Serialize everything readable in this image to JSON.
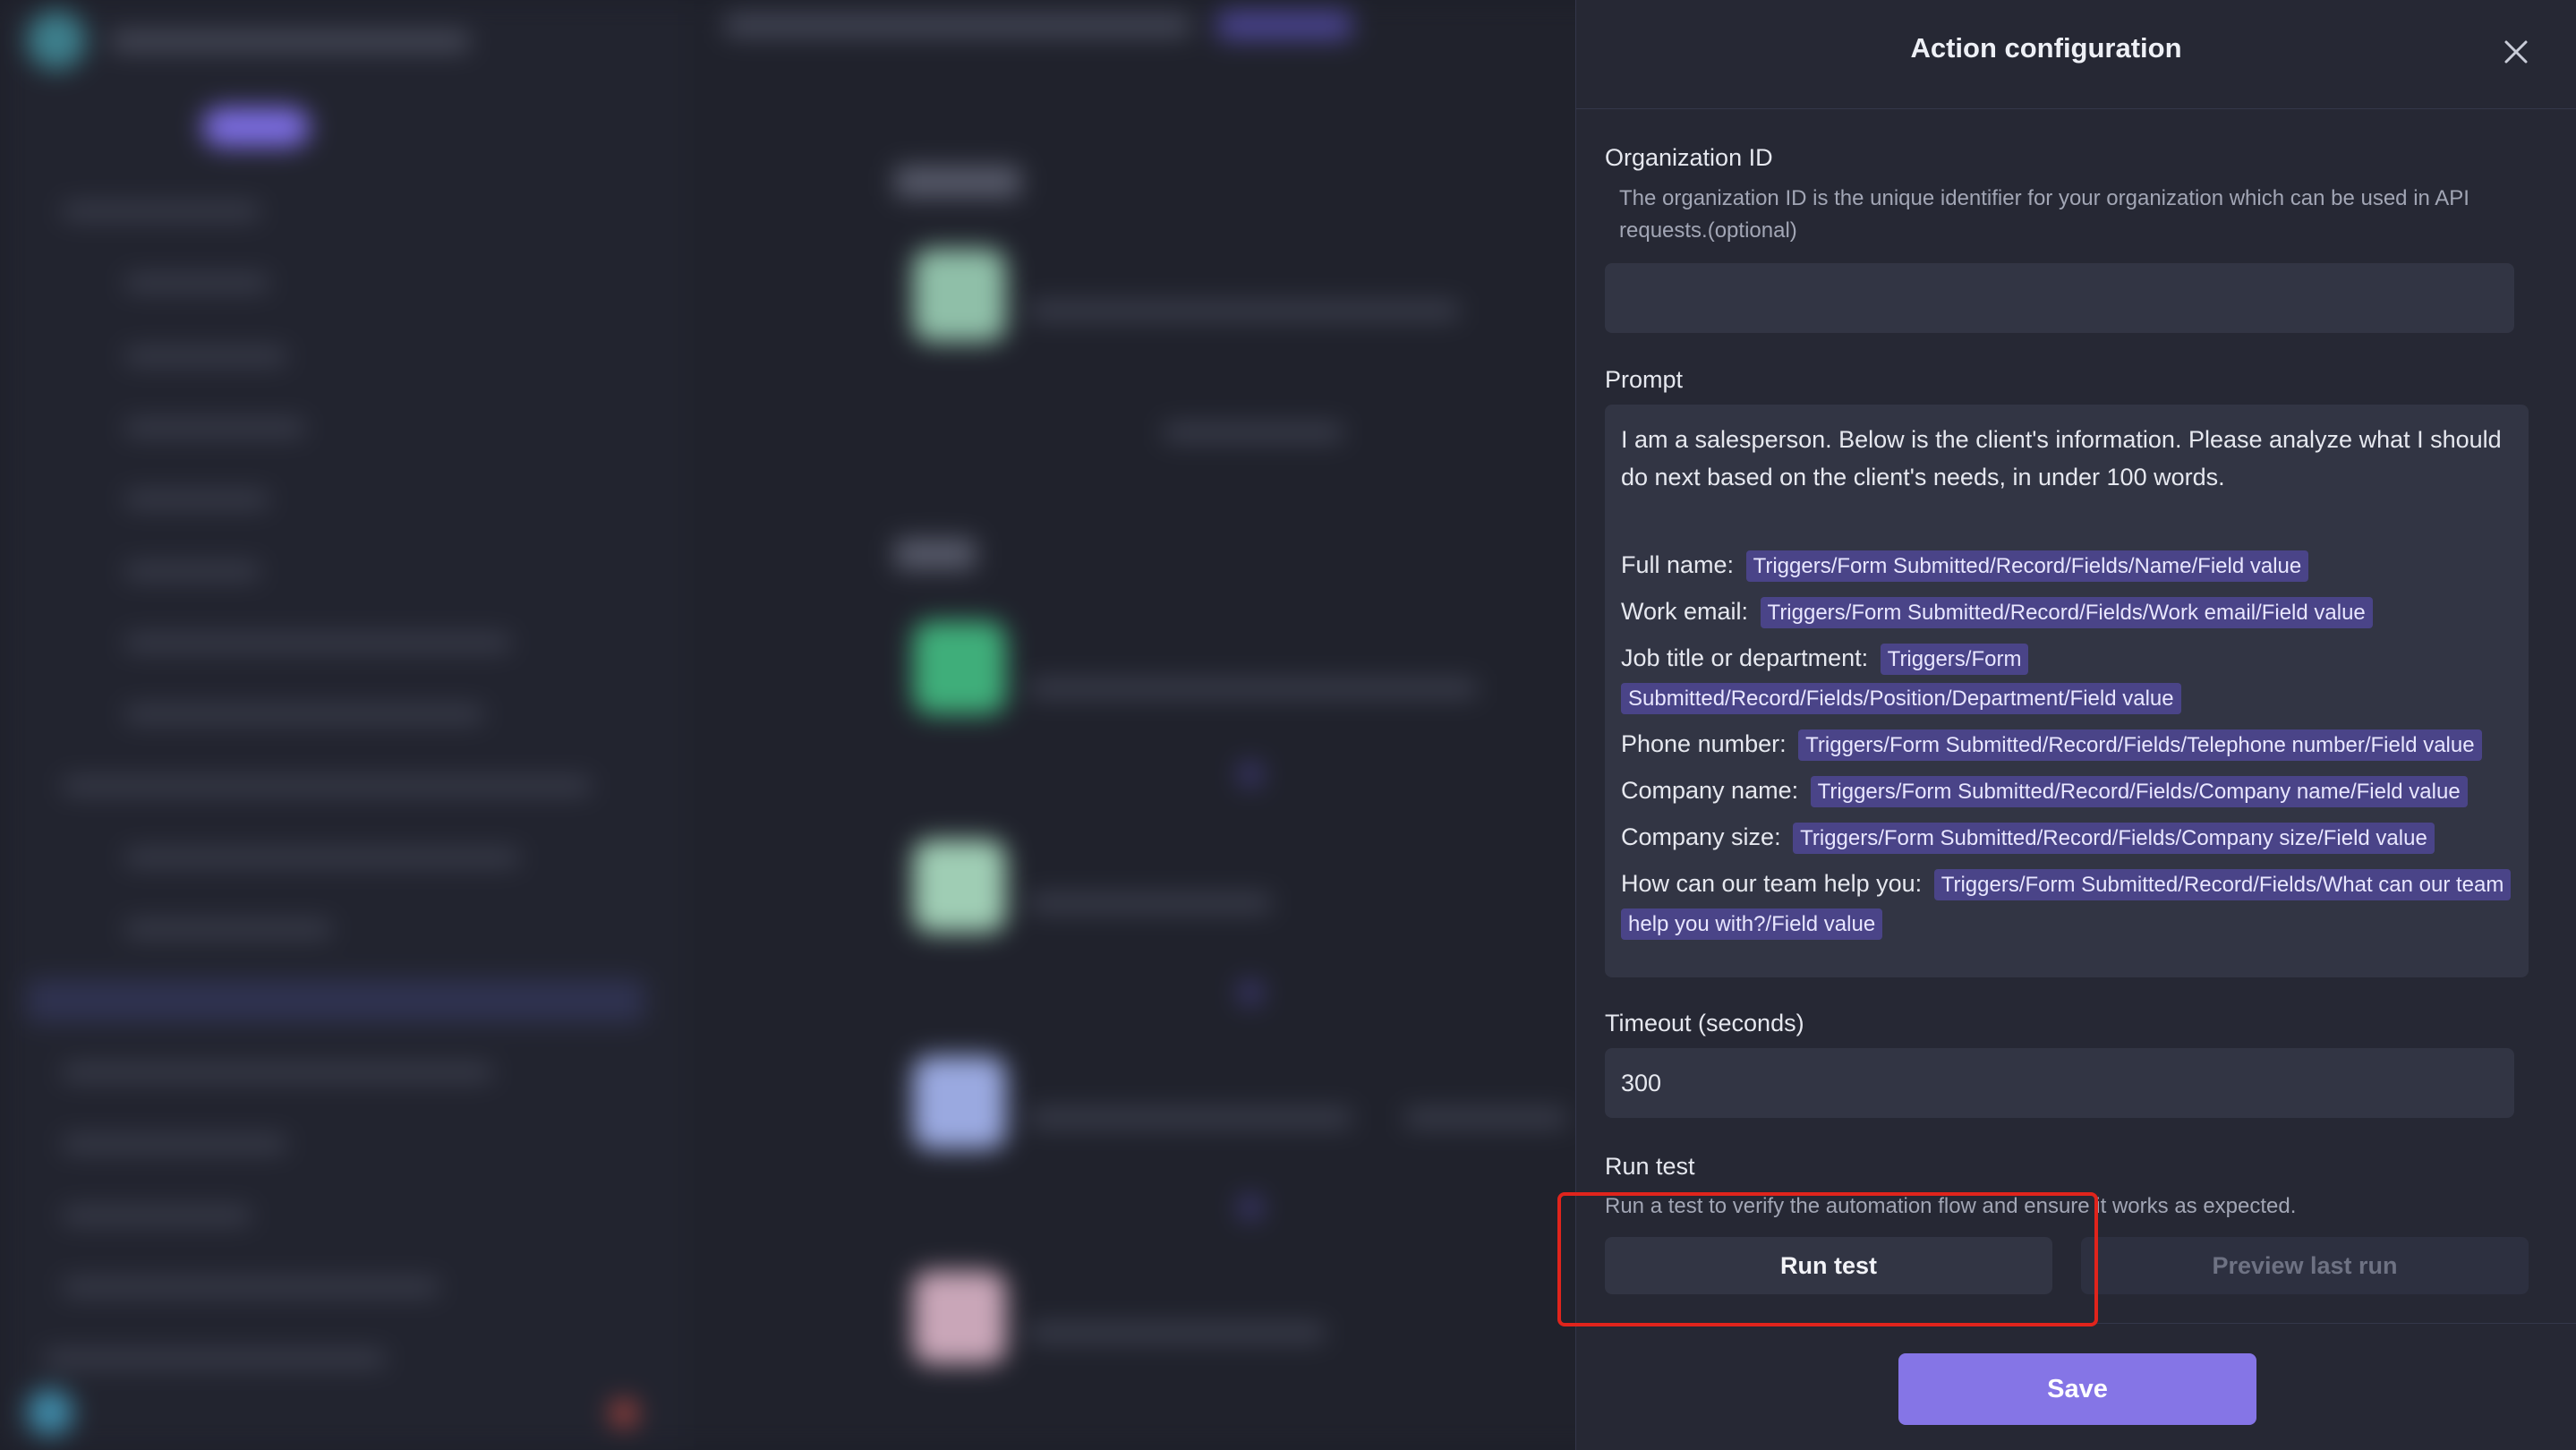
{
  "panel": {
    "title": "Action configuration"
  },
  "organization_id": {
    "label": "Organization ID",
    "description": "The organization ID is the unique identifier for your organization which can be used in API requests.(optional)",
    "value": ""
  },
  "prompt": {
    "label": "Prompt",
    "intro": "I am a salesperson. Below is the client's information. Please analyze what I should do next based on the client's needs, in under 100 words.",
    "fields": [
      {
        "label": "Full name:",
        "token": "Triggers/Form Submitted/Record/Fields/Name/Field value"
      },
      {
        "label": "Work email:",
        "token": "Triggers/Form Submitted/Record/Fields/Work email/Field value"
      },
      {
        "label": "Job title or department:",
        "token": "Triggers/Form Submitted/Record/Fields/Position/Department/Field value"
      },
      {
        "label": "Phone number:",
        "token": "Triggers/Form Submitted/Record/Fields/Telephone number/Field value"
      },
      {
        "label": "Company name:",
        "token": "Triggers/Form Submitted/Record/Fields/Company name/Field value"
      },
      {
        "label": "Company size:",
        "token": "Triggers/Form Submitted/Record/Fields/Company size/Field value"
      },
      {
        "label": "How can our team help you:",
        "token": "Triggers/Form Submitted/Record/Fields/What can our team help you with?/Field value"
      }
    ]
  },
  "timeout": {
    "label": "Timeout (seconds)",
    "value": "300"
  },
  "run_test": {
    "label": "Run test",
    "description": "Run a test to verify the automation flow and ensure it works as expected.",
    "run_button": "Run test",
    "preview_button": "Preview last run"
  },
  "footer": {
    "save_button": "Save"
  },
  "colors": {
    "panel_bg": "#262834",
    "accent": "#8575e6",
    "token_bg": "#4a4488",
    "highlight": "#e0241c"
  },
  "icons": {
    "close": "close-icon"
  }
}
